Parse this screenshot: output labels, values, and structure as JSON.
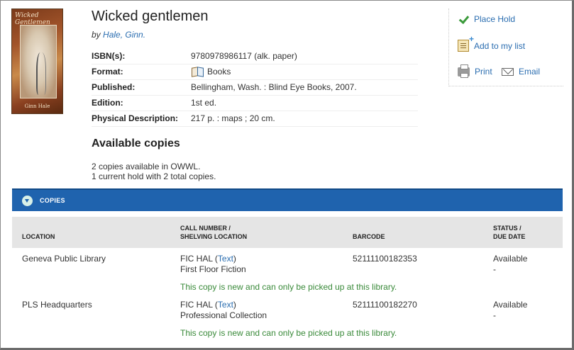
{
  "book": {
    "cover_title": "Wicked Gentlemen",
    "cover_author": "Ginn Hale",
    "title": "Wicked gentlemen",
    "by_label": "by",
    "author": "Hale, Ginn."
  },
  "details": [
    {
      "label": "ISBN(s):",
      "value": "9780978986117 (alk. paper)"
    },
    {
      "label": "Format:",
      "value": "Books",
      "icon": "book-icon"
    },
    {
      "label": "Published:",
      "value": "Bellingham, Wash. : Blind Eye Books, 2007."
    },
    {
      "label": "Edition:",
      "value": "1st ed."
    },
    {
      "label": "Physical Description:",
      "value": "217 p. : maps ; 20 cm."
    }
  ],
  "availability": {
    "heading": "Available copies",
    "line1": "2 copies available in OWWL.",
    "line2": "1 current hold with 2 total copies."
  },
  "actions": {
    "place_hold": "Place Hold",
    "add_to_list": "Add to my list",
    "print": "Print",
    "email": "Email"
  },
  "copies": {
    "bar_label": "COPIES",
    "headers": {
      "location": "LOCATION",
      "call_number_1": "CALL NUMBER /",
      "call_number_2": "SHELVING LOCATION",
      "barcode": "BARCODE",
      "status_1": "STATUS /",
      "status_2": "DUE DATE"
    },
    "rows": [
      {
        "location": "Geneva Public Library",
        "call_number": "FIC HAL",
        "text_link": "Text",
        "shelving": "First Floor Fiction",
        "barcode": "52111100182353",
        "status": "Available",
        "due": "-",
        "note": "This copy is new and can only be picked up at this library."
      },
      {
        "location": "PLS Headquarters",
        "call_number": "FIC HAL",
        "text_link": "Text",
        "shelving": "Professional Collection",
        "barcode": "52111100182270",
        "status": "Available",
        "due": "-",
        "note": "This copy is new and can only be picked up at this library."
      }
    ]
  },
  "colors": {
    "link": "#2a6db0",
    "bar": "#1f63ae",
    "note": "#3a8a3a"
  }
}
